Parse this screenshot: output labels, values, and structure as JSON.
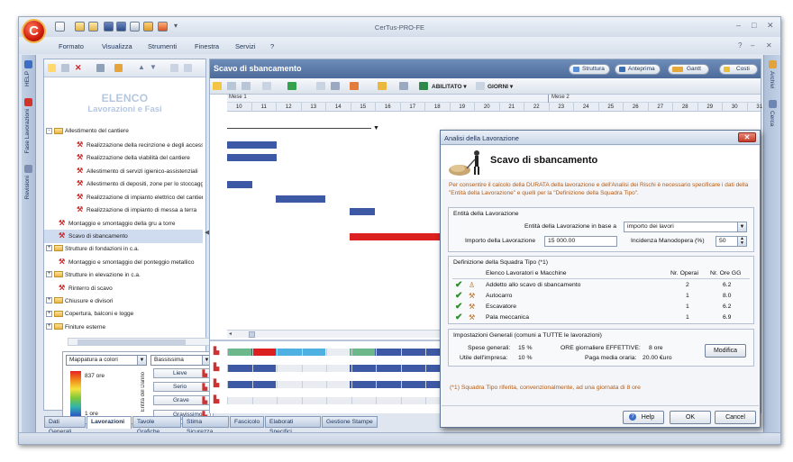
{
  "app": {
    "title": "CerTus-PRO-FE",
    "logo_letter": "C",
    "mdi_help": "?"
  },
  "menu": [
    "Formato",
    "Visualizza",
    "Strumenti",
    "Finestra",
    "Servizi",
    "?"
  ],
  "left_sidebar": [
    "HELP",
    "Fase Lavorazioni",
    "Revisioni"
  ],
  "right_sidebar": [
    "Archivi",
    "Cerca"
  ],
  "tree": {
    "title": "ELENCO",
    "subtitle": "Lavorazioni e Fasi",
    "rows": [
      {
        "label": "Allestimento del cantiere",
        "kind": "folder",
        "level": 0,
        "exp": "-"
      },
      {
        "label": "Realizzazione della recinzione e degli accessi al cantiere",
        "kind": "work",
        "level": 2
      },
      {
        "label": "Realizzazione della viabilità del cantiere",
        "kind": "work",
        "level": 2
      },
      {
        "label": "Allestimento di servizi igienico-assistenziali",
        "kind": "work",
        "level": 2
      },
      {
        "label": "Allestimento di depositi, zone per lo stoccaggio",
        "kind": "work",
        "level": 2
      },
      {
        "label": "Realizzazione di impianto elettrico del cantiere",
        "kind": "work",
        "level": 2
      },
      {
        "label": "Realizzazione di impianto di messa a terra",
        "kind": "work",
        "level": 2
      },
      {
        "label": "Montaggio e smontaggio della gru a torre",
        "kind": "work",
        "level": 1
      },
      {
        "label": "Scavo di sbancamento",
        "kind": "work",
        "level": 1,
        "selected": true
      },
      {
        "label": "Strutture di fondazioni in c.a.",
        "kind": "folder",
        "level": 0,
        "exp": "+"
      },
      {
        "label": "Montaggio e smontaggio del ponteggio metallico",
        "kind": "work",
        "level": 1
      },
      {
        "label": "Strutture in elevazione in c.a.",
        "kind": "folder",
        "level": 0,
        "exp": "+"
      },
      {
        "label": "Rinterro di scavo",
        "kind": "work",
        "level": 1
      },
      {
        "label": "Chiusure e divisori",
        "kind": "folder",
        "level": 0,
        "exp": "+"
      },
      {
        "label": "Copertura, balconi e logge",
        "kind": "folder",
        "level": 0,
        "exp": "+"
      },
      {
        "label": "Finiture esterne",
        "kind": "folder",
        "level": 0,
        "exp": "+"
      }
    ]
  },
  "risk_box": {
    "map_select": "Mappatura a colori",
    "level_select": "Bassissima",
    "max_label": "837 ore",
    "min_label": "1 ore",
    "axis_label": "Entità del Danno",
    "levels": [
      "Lieve",
      "Serio",
      "Grave",
      "Gravissimo"
    ]
  },
  "bottom_tabs": [
    {
      "label": "Dati Generali",
      "active": false
    },
    {
      "label": "Lavorazioni",
      "active": true
    },
    {
      "label": "Tavole Grafiche",
      "active": false
    },
    {
      "label": "Stima Sicurezza",
      "active": false
    },
    {
      "label": "Fascicolo",
      "active": false
    },
    {
      "label": "Elaborati Specifici",
      "active": false
    },
    {
      "label": "Gestione Stampe",
      "active": false
    }
  ],
  "gantt": {
    "title": "Scavo di sbancamento",
    "header_buttons": [
      "Struttura",
      "Anteprima",
      "Gantt",
      "Costi"
    ],
    "toolbar_text": [
      "ABILITATO",
      "GIORNI"
    ],
    "months": [
      "Mese 1",
      "Mese 2"
    ],
    "days": [
      "10",
      "11",
      "12",
      "13",
      "14",
      "15",
      "16",
      "17",
      "18",
      "19",
      "20",
      "21",
      "22",
      "23",
      "24",
      "25",
      "26",
      "27",
      "28",
      "29",
      "30",
      "31"
    ],
    "colors": {
      "bar": "#3d58a4",
      "critical": "#dc2020",
      "green": "#6cb88a",
      "cyan": "#4fb1e2"
    }
  },
  "dialog": {
    "title": "Analisi della Lavorazione",
    "name": "Scavo di sbancamento",
    "description": "Per consentire il calcolo della DURATA della lavorazione e dell'Analisi dei Rischi è necessario specificare i dati della \"Entità della Lavorazione\" e quelli per la \"Definizione della Squadra Tipo\".",
    "entity": {
      "group": "Entità della Lavorazione",
      "basis_label": "Entità della Lavorazione in base a",
      "basis_value": "importo dei lavori",
      "amount_label": "Importo della Lavorazione",
      "amount_value": "15 000.00",
      "incidence_label": "Incidenza Manodopera (%)",
      "incidence_value": "50"
    },
    "team": {
      "group": "Definizione della Squadra Tipo  (*1)",
      "col_name": "Elenco Lavoratori e Macchine",
      "col_ops": "Nr. Operai",
      "col_hours": "Nr. Ore GG",
      "rows": [
        {
          "name": "Addetto allo scavo di sbancamento",
          "ops": "2",
          "hours": "6.2"
        },
        {
          "name": "Autocarro",
          "ops": "1",
          "hours": "8.0"
        },
        {
          "name": "Escavatore",
          "ops": "1",
          "hours": "6.2"
        },
        {
          "name": "Pala meccanica",
          "ops": "1",
          "hours": "6.9"
        }
      ]
    },
    "general": {
      "group": "Impostazioni Generali  (comuni a TUTTE le lavorazioni)",
      "spese_label": "Spese generali:",
      "spese_value": "15 %",
      "utile_label": "Utile dell'impresa:",
      "utile_value": "10 %",
      "ore_label": "ORE giornaliere EFFETTIVE:",
      "ore_value": "8 ore",
      "paga_label": "Paga media oraria:",
      "paga_value": "20.00 €uro",
      "modify_button": "Modifica"
    },
    "note": "(*1) Squadra Tipo riferita, convenzionalmente, ad una giornata di 8 ore",
    "buttons": {
      "help": "Help",
      "ok": "OK",
      "cancel": "Cancel"
    }
  }
}
